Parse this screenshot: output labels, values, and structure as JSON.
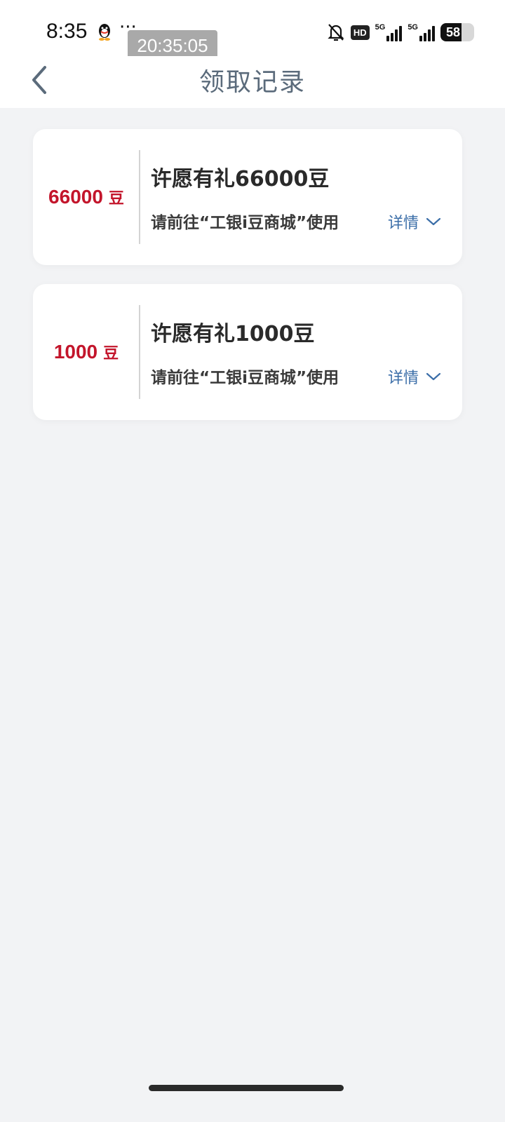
{
  "status_bar": {
    "time": "8:35",
    "more": "···",
    "timestamp": "20:35:05",
    "hd": "HD",
    "net1": "5G",
    "net2": "5G",
    "battery": "58"
  },
  "header": {
    "title": "领取记录"
  },
  "records": [
    {
      "amount": "66000",
      "unit": "豆",
      "title": "许愿有礼66000豆",
      "desc": "请前往“工银i豆商城”使用",
      "detail_label": "详情"
    },
    {
      "amount": "1000",
      "unit": "豆",
      "title": "许愿有礼1000豆",
      "desc": "请前往“工银i豆商城”使用",
      "detail_label": "详情"
    }
  ],
  "colors": {
    "amount": "#c3152b",
    "link": "#3b6ea8",
    "title_gray": "#5b6b7b",
    "page_bg": "#f2f3f5"
  }
}
